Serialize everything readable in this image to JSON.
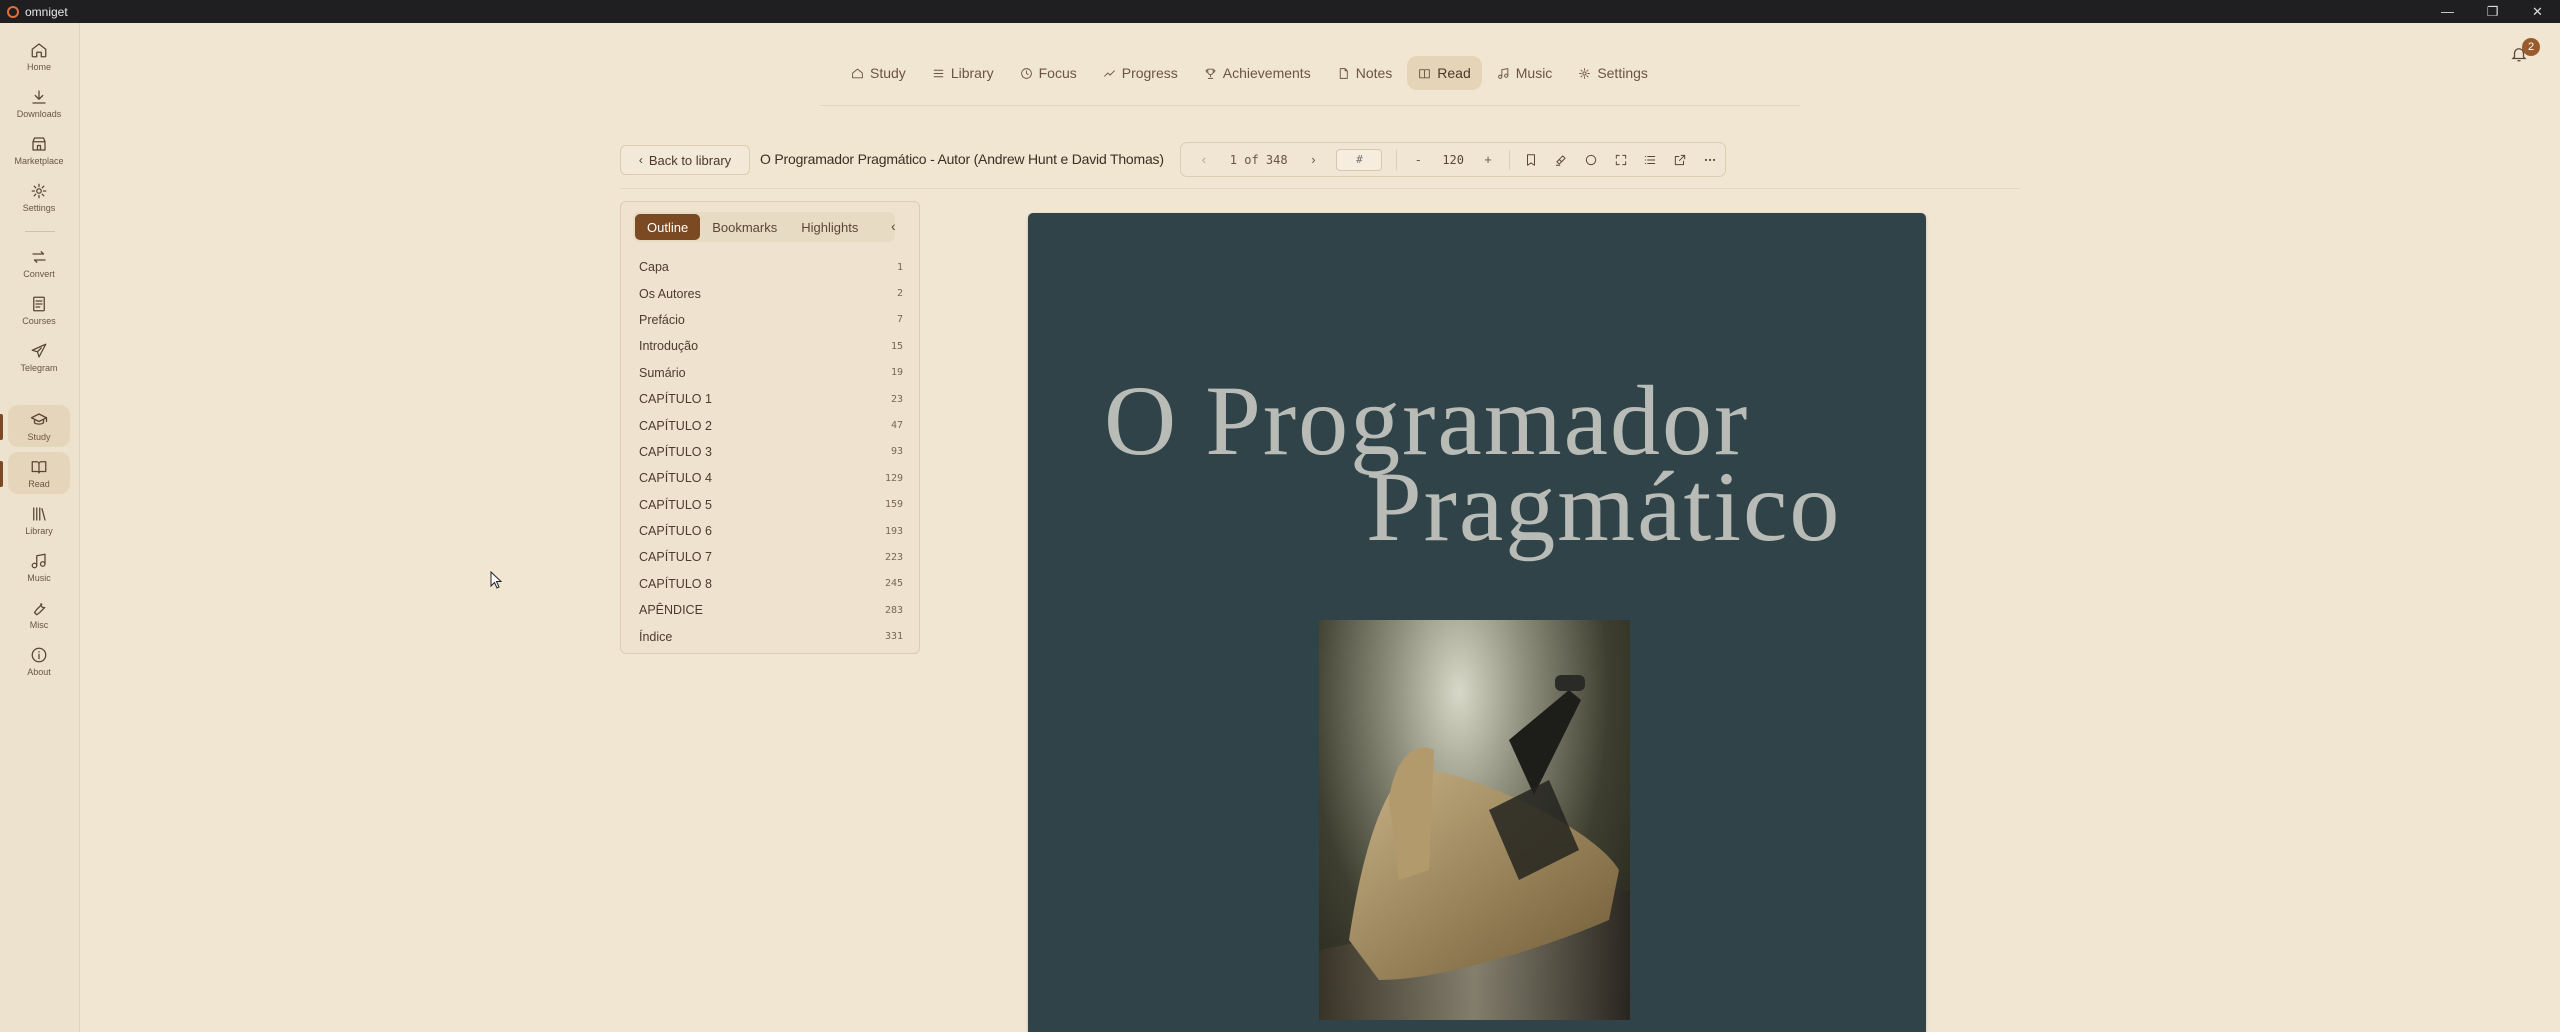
{
  "window": {
    "title": "omniget"
  },
  "sidebar": {
    "items": [
      {
        "label": "Home",
        "icon": "home-icon"
      },
      {
        "label": "Downloads",
        "icon": "download-icon"
      },
      {
        "label": "Marketplace",
        "icon": "store-icon"
      },
      {
        "label": "Settings",
        "icon": "gear-icon"
      },
      {
        "label": "Convert",
        "icon": "convert-icon"
      },
      {
        "label": "Courses",
        "icon": "courses-icon"
      },
      {
        "label": "Telegram",
        "icon": "telegram-icon"
      },
      {
        "label": "Study",
        "icon": "graduation-cap-icon"
      },
      {
        "label": "Read",
        "icon": "book-open-icon"
      },
      {
        "label": "Library",
        "icon": "library-icon"
      },
      {
        "label": "Music",
        "icon": "music-icon"
      },
      {
        "label": "Misc",
        "icon": "wrench-icon"
      },
      {
        "label": "About",
        "icon": "info-icon"
      }
    ]
  },
  "topnav": {
    "items": [
      {
        "label": "Study",
        "icon": "home-icon"
      },
      {
        "label": "Library",
        "icon": "list-icon"
      },
      {
        "label": "Focus",
        "icon": "clock-icon"
      },
      {
        "label": "Progress",
        "icon": "trend-icon"
      },
      {
        "label": "Achievements",
        "icon": "trophy-icon"
      },
      {
        "label": "Notes",
        "icon": "note-icon"
      },
      {
        "label": "Read",
        "icon": "book-icon"
      },
      {
        "label": "Music",
        "icon": "music-icon"
      },
      {
        "label": "Settings",
        "icon": "gear-icon"
      }
    ],
    "active": "Read"
  },
  "notifications": {
    "count": "2"
  },
  "reader": {
    "back_label": "Back to library",
    "book_title": "O Programador Pragmático - Autor (Andrew Hunt e David Thomas)",
    "page_indicator": "1 of 348",
    "page_input_placeholder": "#",
    "zoom_minus": "-",
    "zoom_value": "120",
    "zoom_plus": "+"
  },
  "outline_panel": {
    "tabs": [
      "Outline",
      "Bookmarks",
      "Highlights"
    ],
    "active_tab": "Outline",
    "collapse_glyph": "‹",
    "entries": [
      {
        "title": "Capa",
        "page": "1"
      },
      {
        "title": "Os Autores",
        "page": "2"
      },
      {
        "title": "Prefácio",
        "page": "7"
      },
      {
        "title": "Introdução",
        "page": "15"
      },
      {
        "title": "Sumário",
        "page": "19"
      },
      {
        "title": "CAPÍTULO 1",
        "page": "23"
      },
      {
        "title": "CAPÍTULO 2",
        "page": "47"
      },
      {
        "title": "CAPÍTULO 3",
        "page": "93"
      },
      {
        "title": "CAPÍTULO 4",
        "page": "129"
      },
      {
        "title": "CAPÍTULO 5",
        "page": "159"
      },
      {
        "title": "CAPÍTULO 6",
        "page": "193"
      },
      {
        "title": "CAPÍTULO 7",
        "page": "223"
      },
      {
        "title": "CAPÍTULO 8",
        "page": "245"
      },
      {
        "title": "APÊNDICE",
        "page": "283"
      },
      {
        "title": "Índice",
        "page": "331"
      }
    ]
  },
  "cover": {
    "line1": "O Programador",
    "line2": "Pragmático",
    "background_color": "#2f4349"
  },
  "colors": {
    "accent": "#7c4a22",
    "background": "#f1e6d2"
  }
}
